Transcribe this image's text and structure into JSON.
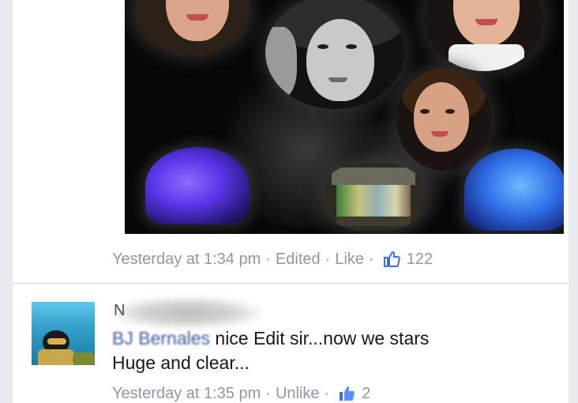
{
  "post": {
    "meta": {
      "timestamp": "Yesterday at 1:34 pm",
      "edited_label": "Edited",
      "like_label": "Like",
      "separator": "·",
      "like_count": "122"
    }
  },
  "comment": {
    "author_initial": "N",
    "mention_name": "BJ Bernales",
    "text_line1": " nice Edit sir...now we stars",
    "text_line2": "Huge and clear...",
    "meta": {
      "timestamp": "Yesterday at 1:35 pm",
      "unlike_label": "Unlike",
      "separator": "·",
      "like_count": "2"
    }
  },
  "colors": {
    "meta_gray": "#9197a3",
    "link_blue": "#3b5998",
    "like_blue": "#5890ff",
    "text": "#141823"
  },
  "icons": {
    "like": "thumbs-up-icon"
  }
}
